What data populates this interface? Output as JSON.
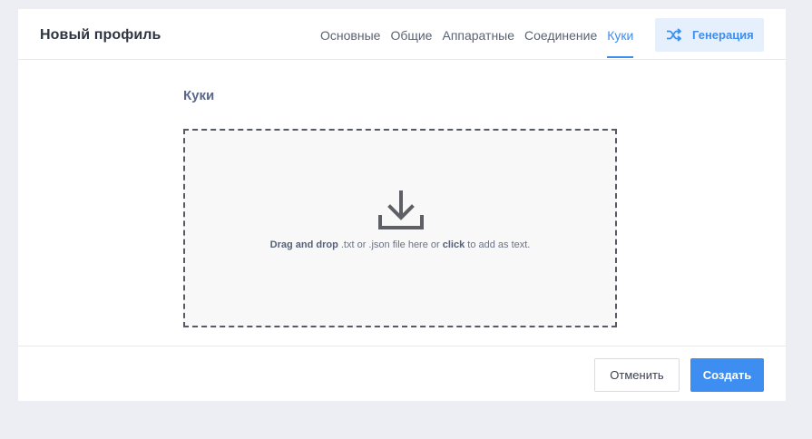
{
  "header": {
    "title": "Новый профиль",
    "tabs": [
      {
        "label": "Основные",
        "active": false
      },
      {
        "label": "Общие",
        "active": false
      },
      {
        "label": "Аппаратные",
        "active": false
      },
      {
        "label": "Соединение",
        "active": false
      },
      {
        "label": "Куки",
        "active": true
      }
    ],
    "generate_button": {
      "label": "Генерация",
      "icon": "shuffle-icon"
    }
  },
  "main": {
    "section_title": "Куки",
    "dropzone": {
      "icon": "download-icon",
      "text_bold_1": "Drag and drop",
      "text_mid": " .txt or .json file here or ",
      "text_bold_2": "click",
      "text_end": " to add as text."
    }
  },
  "footer": {
    "cancel_label": "Отменить",
    "create_label": "Создать"
  },
  "colors": {
    "accent": "#3d8ef0",
    "background": "#eceef3",
    "accent_light": "#e6f0fc"
  }
}
